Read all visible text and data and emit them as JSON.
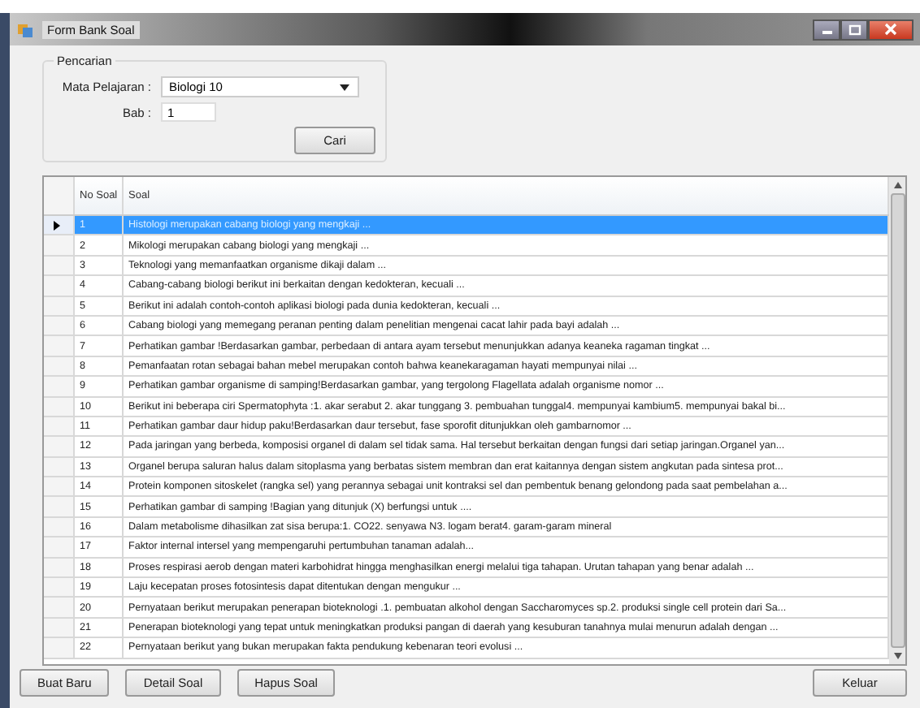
{
  "window": {
    "title": "Form Bank Soal"
  },
  "search": {
    "title": "Pencarian",
    "subject_label": "Mata Pelajaran :",
    "subject_value": "Biologi 10",
    "chapter_label": "Bab :",
    "chapter_value": "1",
    "search_button": "Cari"
  },
  "table": {
    "columns": [
      "No Soal",
      "Soal"
    ],
    "rows": [
      {
        "no": "1",
        "soal": "Histologi merupakan cabang biologi yang mengkaji ...",
        "selected": true
      },
      {
        "no": "2",
        "soal": "Mikologi merupakan cabang biologi yang mengkaji ...",
        "selected": false
      },
      {
        "no": "3",
        "soal": "Teknologi yang memanfaatkan organisme dikaji dalam ...",
        "selected": false
      },
      {
        "no": "4",
        "soal": "Cabang-cabang biologi berikut ini berkaitan dengan kedokteran, kecuali ...",
        "selected": false
      },
      {
        "no": "5",
        "soal": "Berikut ini adalah contoh-contoh aplikasi biologi pada dunia kedokteran, kecuali ...",
        "selected": false
      },
      {
        "no": "6",
        "soal": "Cabang biologi yang memegang peranan penting dalam penelitian mengenai cacat lahir pada bayi adalah ...",
        "selected": false
      },
      {
        "no": "7",
        "soal": "Perhatikan gambar !Berdasarkan gambar, perbedaan di antara ayam tersebut menunjukkan adanya keaneka ragaman tingkat ...",
        "selected": false
      },
      {
        "no": "8",
        "soal": "Pemanfaatan rotan sebagai bahan mebel merupakan contoh bahwa keanekaragaman hayati mempunyai nilai ...",
        "selected": false
      },
      {
        "no": "9",
        "soal": "Perhatikan gambar organisme di samping!Berdasarkan gambar, yang tergolong Flagellata adalah organisme nomor ...",
        "selected": false
      },
      {
        "no": "10",
        "soal": "Berikut ini beberapa ciri Spermatophyta :1. akar serabut 2. akar tunggang 3. pembuahan tunggal4. mempunyai kambium5. mempunyai bakal bi...",
        "selected": false
      },
      {
        "no": "11",
        "soal": "Perhatikan gambar daur hidup paku!Berdasarkan daur tersebut, fase sporofit ditunjukkan oleh gambarnomor ...",
        "selected": false
      },
      {
        "no": "12",
        "soal": "Pada jaringan yang berbeda, komposisi organel di dalam sel tidak sama. Hal tersebut berkaitan dengan fungsi dari setiap jaringan.Organel yan...",
        "selected": false
      },
      {
        "no": "13",
        "soal": "Organel berupa saluran halus dalam sitoplasma yang berbatas sistem membran dan erat kaitannya dengan sistem angkutan pada sintesa prot...",
        "selected": false
      },
      {
        "no": "14",
        "soal": "Protein komponen sitoskelet (rangka sel) yang perannya sebagai unit kontraksi sel dan pembentuk benang gelondong pada saat pembelahan a...",
        "selected": false
      },
      {
        "no": "15",
        "soal": "Perhatikan gambar di samping !Bagian yang ditunjuk (X) berfungsi untuk ....",
        "selected": false
      },
      {
        "no": "16",
        "soal": "Dalam metabolisme dihasilkan zat sisa berupa:1. CO22. senyawa N3. logam berat4. garam-garam mineral",
        "selected": false
      },
      {
        "no": "17",
        "soal": "Faktor internal intersel yang mempengaruhi pertumbuhan tanaman adalah...",
        "selected": false
      },
      {
        "no": "18",
        "soal": "Proses respirasi aerob dengan materi karbohidrat hingga menghasilkan energi melalui tiga tahapan. Urutan tahapan yang benar adalah ...",
        "selected": false
      },
      {
        "no": "19",
        "soal": "Laju kecepatan proses fotosintesis dapat ditentukan dengan mengukur ...",
        "selected": false
      },
      {
        "no": "20",
        "soal": "Pernyataan berikut merupakan penerapan bioteknologi .1. pembuatan alkohol dengan Saccharomyces sp.2. produksi single cell protein dari Sa...",
        "selected": false
      },
      {
        "no": "21",
        "soal": "Penerapan bioteknologi yang tepat untuk meningkatkan produksi pangan di daerah yang kesuburan tanahnya mulai menurun adalah dengan ...",
        "selected": false
      },
      {
        "no": "22",
        "soal": "Pernyataan berikut yang bukan merupakan fakta pendukung kebenaran teori evolusi ...",
        "selected": false
      }
    ]
  },
  "buttons": [
    "Buat Baru",
    "Detail Soal",
    "Hapus Soal"
  ],
  "exit_button": "Keluar"
}
